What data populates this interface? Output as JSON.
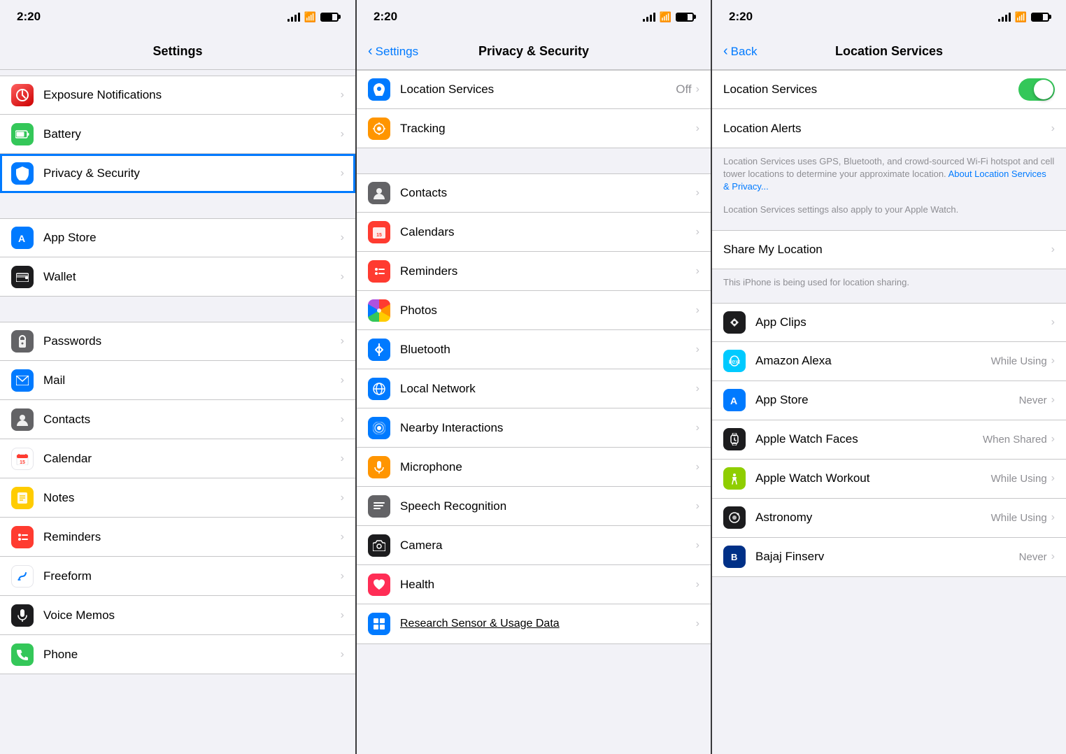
{
  "panel1": {
    "statusBar": {
      "time": "2:20",
      "signalBars": [
        4,
        7,
        10,
        13
      ],
      "wifi": "wifi",
      "battery": "battery"
    },
    "navTitle": "Settings",
    "rows": [
      {
        "id": "exposure",
        "label": "Exposure Notifications",
        "iconClass": "app-icon-exposure",
        "iconSymbol": "🔴",
        "iconText": "⚙",
        "hasChevron": true
      },
      {
        "id": "battery",
        "label": "Battery",
        "iconClass": "app-icon-battery",
        "iconText": "🔋",
        "hasChevron": true
      },
      {
        "id": "privacy",
        "label": "Privacy & Security",
        "iconClass": "app-icon-privacy",
        "iconText": "✋",
        "hasChevron": true,
        "highlighted": true
      },
      {
        "id": "appstore",
        "label": "App Store",
        "iconClass": "app-icon-appstore",
        "iconText": "A",
        "hasChevron": true
      },
      {
        "id": "wallet",
        "label": "Wallet",
        "iconClass": "app-icon-wallet",
        "iconText": "▤",
        "hasChevron": true
      },
      {
        "id": "passwords",
        "label": "Passwords",
        "iconClass": "app-icon-passwords",
        "iconText": "🔑",
        "hasChevron": true
      },
      {
        "id": "mail",
        "label": "Mail",
        "iconClass": "app-icon-mail",
        "iconText": "✉",
        "hasChevron": true
      },
      {
        "id": "contacts",
        "label": "Contacts",
        "iconClass": "app-icon-contacts",
        "iconText": "👤",
        "hasChevron": true
      },
      {
        "id": "calendar",
        "label": "Calendar",
        "iconClass": "app-icon-calendar",
        "iconText": "📅",
        "hasChevron": true
      },
      {
        "id": "notes",
        "label": "Notes",
        "iconClass": "app-icon-notes",
        "iconText": "📝",
        "hasChevron": true
      },
      {
        "id": "reminders",
        "label": "Reminders",
        "iconClass": "app-icon-reminders",
        "iconText": "⊙",
        "hasChevron": true
      },
      {
        "id": "freeform",
        "label": "Freeform",
        "iconClass": "app-icon-freeform",
        "iconText": "✏",
        "hasChevron": true
      },
      {
        "id": "voicememos",
        "label": "Voice Memos",
        "iconClass": "app-icon-voicememos",
        "iconText": "🎙",
        "hasChevron": true
      },
      {
        "id": "phone",
        "label": "Phone",
        "iconClass": "app-icon-phone",
        "iconText": "📞",
        "hasChevron": true
      }
    ]
  },
  "panel2": {
    "statusBar": {
      "time": "2:20"
    },
    "navBack": "Settings",
    "navTitle": "Privacy & Security",
    "rows": [
      {
        "id": "location",
        "label": "Location Services",
        "value": "Off",
        "iconClass": "priv-location",
        "iconText": "▶",
        "hasChevron": true,
        "highlighted": true
      },
      {
        "id": "tracking",
        "label": "Tracking",
        "iconClass": "priv-tracking",
        "iconText": "⊕",
        "hasChevron": true
      },
      {
        "id": "contacts",
        "label": "Contacts",
        "iconClass": "priv-contacts",
        "iconText": "👤",
        "hasChevron": true
      },
      {
        "id": "calendars",
        "label": "Calendars",
        "iconClass": "priv-calendars",
        "iconText": "📅",
        "hasChevron": true
      },
      {
        "id": "reminders",
        "label": "Reminders",
        "iconClass": "priv-reminders",
        "iconText": "⊙",
        "hasChevron": true
      },
      {
        "id": "photos",
        "label": "Photos",
        "iconClass": "priv-photos",
        "iconText": "🌸",
        "hasChevron": true
      },
      {
        "id": "bluetooth",
        "label": "Bluetooth",
        "iconClass": "priv-bluetooth",
        "iconText": "Ƀ",
        "hasChevron": true
      },
      {
        "id": "localnetwork",
        "label": "Local Network",
        "iconClass": "priv-localnetwork",
        "iconText": "🌐",
        "hasChevron": true
      },
      {
        "id": "nearby",
        "label": "Nearby Interactions",
        "iconClass": "priv-nearby",
        "iconText": "◎",
        "hasChevron": true
      },
      {
        "id": "microphone",
        "label": "Microphone",
        "iconClass": "priv-microphone",
        "iconText": "🎙",
        "hasChevron": true
      },
      {
        "id": "speech",
        "label": "Speech Recognition",
        "iconClass": "priv-speech",
        "iconText": "≡≡",
        "hasChevron": true
      },
      {
        "id": "camera",
        "label": "Camera",
        "iconClass": "priv-camera",
        "iconText": "📷",
        "hasChevron": true
      },
      {
        "id": "health",
        "label": "Health",
        "iconClass": "priv-health",
        "iconText": "♥",
        "hasChevron": true
      },
      {
        "id": "research",
        "label": "Research Sensor & Usage Data",
        "iconClass": "priv-research",
        "iconText": "⊞",
        "hasChevron": true
      }
    ]
  },
  "panel3": {
    "statusBar": {
      "time": "2:20"
    },
    "navBack": "Back",
    "navTitle": "Location Services",
    "toggleLabel": "Location Services",
    "toggleOn": true,
    "locationAlerts": "Location Alerts",
    "description1": "Location Services uses GPS, Bluetooth, and crowd-sourced Wi-Fi hotspot and cell tower locations to determine your approximate location.",
    "descriptionLink": "About Location Services & Privacy...",
    "description2": "Location Services settings also apply to your Apple Watch.",
    "shareMyLocation": "Share My Location",
    "shareDesc": "This iPhone is being used for location sharing.",
    "apps": [
      {
        "id": "appclips",
        "label": "App Clips",
        "value": "",
        "iconClass": "loc-appclips",
        "iconText": "✂"
      },
      {
        "id": "alexa",
        "label": "Amazon Alexa",
        "value": "While Using",
        "iconClass": "loc-alexa",
        "iconText": "alexa"
      },
      {
        "id": "appstore",
        "label": "App Store",
        "value": "Never",
        "iconClass": "loc-appstore",
        "iconText": "A"
      },
      {
        "id": "applewatch",
        "label": "Apple Watch Faces",
        "value": "When Shared",
        "iconClass": "loc-applewatch",
        "iconText": "⌚"
      },
      {
        "id": "watchworkout",
        "label": "Apple Watch Workout",
        "value": "While Using",
        "iconClass": "loc-watchworkout",
        "iconText": "🏃"
      },
      {
        "id": "astronomy",
        "label": "Astronomy",
        "value": "While Using",
        "iconClass": "loc-astronomy",
        "iconText": "◉"
      },
      {
        "id": "bajaj",
        "label": "Bajaj Finserv",
        "value": "Never",
        "iconClass": "loc-bajaj",
        "iconText": "B"
      }
    ]
  }
}
